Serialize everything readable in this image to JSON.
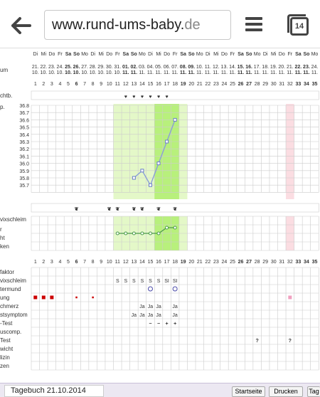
{
  "browser": {
    "url_main": "www.rund-ums-baby.",
    "url_tail": "de",
    "tab_count": "14"
  },
  "days": [
    "Di",
    "Mi",
    "Do",
    "Fr",
    "Sa",
    "So",
    "Mo",
    "Di",
    "Mi",
    "Do",
    "Fr",
    "Sa",
    "So",
    "Mo",
    "Di",
    "Mi",
    "Do",
    "Fr",
    "Sa",
    "So",
    "Mo",
    "Di",
    "Mi",
    "Do",
    "Fr",
    "Sa",
    "So",
    "Mo",
    "Di",
    "Mi",
    "Do",
    "Fr",
    "Sa",
    "So",
    "Mo"
  ],
  "dates": [
    "21.",
    "22.",
    "23.",
    "24.",
    "25.",
    "26.",
    "27.",
    "28.",
    "29.",
    "30.",
    "31.",
    "01.",
    "02.",
    "03.",
    "04.",
    "05.",
    "06.",
    "07.",
    "08.",
    "09.",
    "10.",
    "11.",
    "12.",
    "13.",
    "14.",
    "15.",
    "16.",
    "17.",
    "18.",
    "19.",
    "20.",
    "21.",
    "22.",
    "23.",
    "24."
  ],
  "months": [
    "10.",
    "10.",
    "10.",
    "10.",
    "10.",
    "10.",
    "10.",
    "10.",
    "10.",
    "10.",
    "10.",
    "11.",
    "11.",
    "11.",
    "11.",
    "11.",
    "11.",
    "11.",
    "11.",
    "11.",
    "11.",
    "11.",
    "11.",
    "11.",
    "11.",
    "11.",
    "11.",
    "11.",
    "11.",
    "11.",
    "11.",
    "11.",
    "11.",
    "11.",
    "11."
  ],
  "cycle_days": [
    "1",
    "2",
    "3",
    "4",
    "5",
    "6",
    "7",
    "8",
    "9",
    "10",
    "11",
    "12",
    "13",
    "14",
    "15",
    "16",
    "17",
    "18",
    "19",
    "20",
    "21",
    "22",
    "23",
    "24",
    "25",
    "26",
    "27",
    "28",
    "29",
    "30",
    "31",
    "32",
    "33",
    "34",
    "35"
  ],
  "labels": {
    "datum": "um",
    "verkehr": "chtb.",
    "temp": "p.",
    "schleim": "vixschleim",
    "s2": "r",
    "s3": "ht",
    "s4": "ken",
    "faktor": "faktor",
    "zervixschleim": "vixschleim",
    "muttermund": "termund",
    "blutung": "ung",
    "mittelschmerz": "chmerz",
    "brust": "stsymptom",
    "lh": "-Test",
    "computer": "uscomp.",
    "test": "Test",
    "gewicht": "wicht",
    "medizin": "lizin",
    "notizen": "zen"
  },
  "chart_data": {
    "type": "line",
    "y_ticks": [
      "36.8",
      "36.7",
      "36.6",
      "36.5",
      "36.4",
      "36.3",
      "36.2",
      "36.1",
      "36.0",
      "35.9",
      "35.8",
      "35.7"
    ],
    "ylim": [
      35.6,
      36.85
    ],
    "temps": [
      {
        "day": 13,
        "value": 35.8
      },
      {
        "day": 14,
        "value": 35.9
      },
      {
        "day": 15,
        "value": 35.7
      },
      {
        "day": 16,
        "value": 36.0
      },
      {
        "day": 17,
        "value": 36.3
      },
      {
        "day": 18,
        "value": 36.6
      }
    ],
    "secondary": [
      {
        "day": 11,
        "level": 0
      },
      {
        "day": 12,
        "level": 0
      },
      {
        "day": 13,
        "level": 0
      },
      {
        "day": 14,
        "level": 0
      },
      {
        "day": 15,
        "level": 0
      },
      {
        "day": 16,
        "level": 0
      },
      {
        "day": 17,
        "level": 1
      },
      {
        "day": 18,
        "level": 1
      }
    ],
    "fertile_light": [
      11,
      19
    ],
    "fertile_dark": [
      16,
      18
    ],
    "pink_day": 32
  },
  "hearts": [
    {
      "day": 12,
      "color": "#7ccc3c"
    },
    {
      "day": 13,
      "color": "#7ccc3c"
    },
    {
      "day": 14,
      "color": "#e040a0"
    },
    {
      "day": 15,
      "color": "#e040a0"
    },
    {
      "day": 16,
      "color": "#e040a0"
    },
    {
      "day": 17,
      "color": "#e040a0"
    }
  ],
  "ducks": [
    6,
    10,
    11,
    13,
    14,
    16,
    18
  ],
  "symbols": {
    "S": [
      {
        "day": 11,
        "text": "S"
      },
      {
        "day": 12,
        "text": "S"
      },
      {
        "day": 13,
        "text": "S"
      },
      {
        "day": 14,
        "text": "S"
      },
      {
        "day": 15,
        "text": "S"
      },
      {
        "day": 16,
        "text": "S"
      },
      {
        "day": 17,
        "text": "SI"
      },
      {
        "day": 18,
        "text": "SI"
      }
    ],
    "mm": [
      15,
      18
    ],
    "blood": [
      {
        "day": 1,
        "size": "big"
      },
      {
        "day": 2,
        "size": "big"
      },
      {
        "day": 3,
        "size": "big"
      },
      {
        "day": 6,
        "size": "small"
      },
      {
        "day": 8,
        "size": "small"
      },
      {
        "day": 32,
        "size": "pink"
      }
    ],
    "ms": [
      {
        "day": 14,
        "text": "Ja"
      },
      {
        "day": 15,
        "text": "Ja"
      },
      {
        "day": 16,
        "text": "Ja"
      },
      {
        "day": 18,
        "text": "Ja"
      }
    ],
    "bs": [
      {
        "day": 13,
        "text": "Ja"
      },
      {
        "day": 14,
        "text": "Ja"
      },
      {
        "day": 15,
        "text": "Ja"
      },
      {
        "day": 16,
        "text": "Ja"
      },
      {
        "day": 18,
        "text": "Ja"
      }
    ],
    "lh": [
      {
        "day": 15,
        "text": "−",
        "color": "#2a9a4a"
      },
      {
        "day": 16,
        "text": "−",
        "color": "#2a9a4a"
      },
      {
        "day": 17,
        "text": "+",
        "color": "#d00"
      },
      {
        "day": 18,
        "text": "+",
        "color": "#d00"
      }
    ],
    "test": [
      {
        "day": 28,
        "text": "?"
      },
      {
        "day": 32,
        "text": "?"
      }
    ]
  },
  "footer": {
    "diary": "Tagebuch 21.10.2014",
    "home": "Startseite",
    "print": "Drucken",
    "tag": "Tag"
  }
}
